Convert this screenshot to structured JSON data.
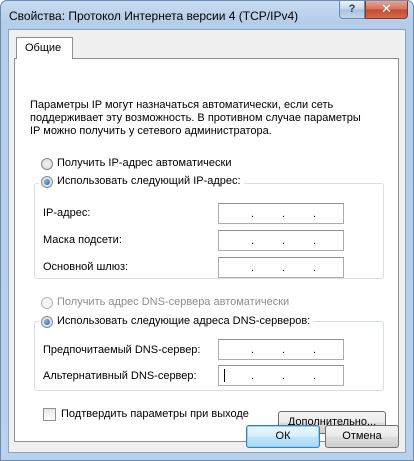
{
  "window": {
    "title": "Свойства: Протокол Интернета версии 4 (TCP/IPv4)",
    "help_glyph": "?",
    "close_glyph": "✕"
  },
  "tabs": [
    {
      "label": "Общие"
    }
  ],
  "description": [
    "Параметры IP могут назначаться автоматически, если сеть",
    "поддерживает эту возможность. В противном случае параметры",
    "IP можно получить у сетевого администратора."
  ],
  "ip": {
    "auto_label": "Получить IP-адрес автоматически",
    "manual_label": "Использовать следующий IP-адрес:",
    "fields": [
      {
        "label": "IP-адрес:"
      },
      {
        "label": "Маска подсети:"
      },
      {
        "label": "Основной шлюз:"
      }
    ]
  },
  "dns": {
    "auto_label": "Получить адрес DNS-сервера автоматически",
    "manual_label": "Использовать следующие адреса DNS-серверов:",
    "fields": [
      {
        "label": "Предпочитаемый DNS-сервер:"
      },
      {
        "label": "Альтернативный DNS-сервер:"
      }
    ]
  },
  "ip_dot": ".",
  "validate_label": "Подтвердить параметры при выходе",
  "advanced_label": "Дополнительно...",
  "ok_label": "ОК",
  "cancel_label": "Отмена"
}
